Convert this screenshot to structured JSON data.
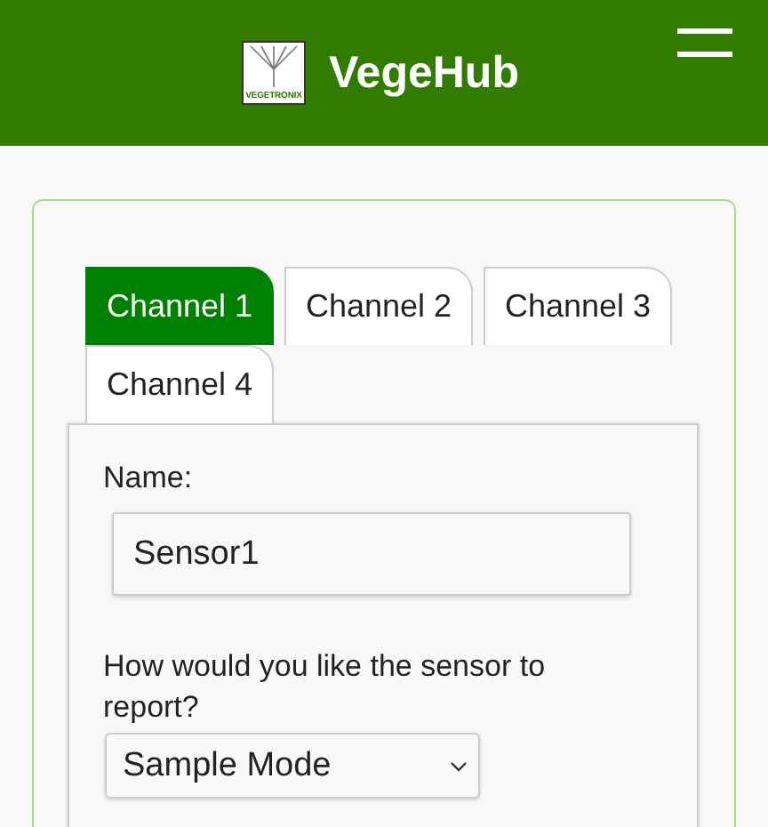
{
  "header": {
    "logo_text": "VEGETRONIX",
    "title": "VegeHub"
  },
  "tabs": [
    {
      "label": "Channel 1",
      "selected": true
    },
    {
      "label": "Channel 2",
      "selected": false
    },
    {
      "label": "Channel 3",
      "selected": false
    },
    {
      "label": "Channel 4",
      "selected": false
    }
  ],
  "form": {
    "name_label": "Name:",
    "name_value": "Sensor1",
    "report_label": "How would you like the sensor to report?",
    "report_value": "Sample Mode"
  }
}
